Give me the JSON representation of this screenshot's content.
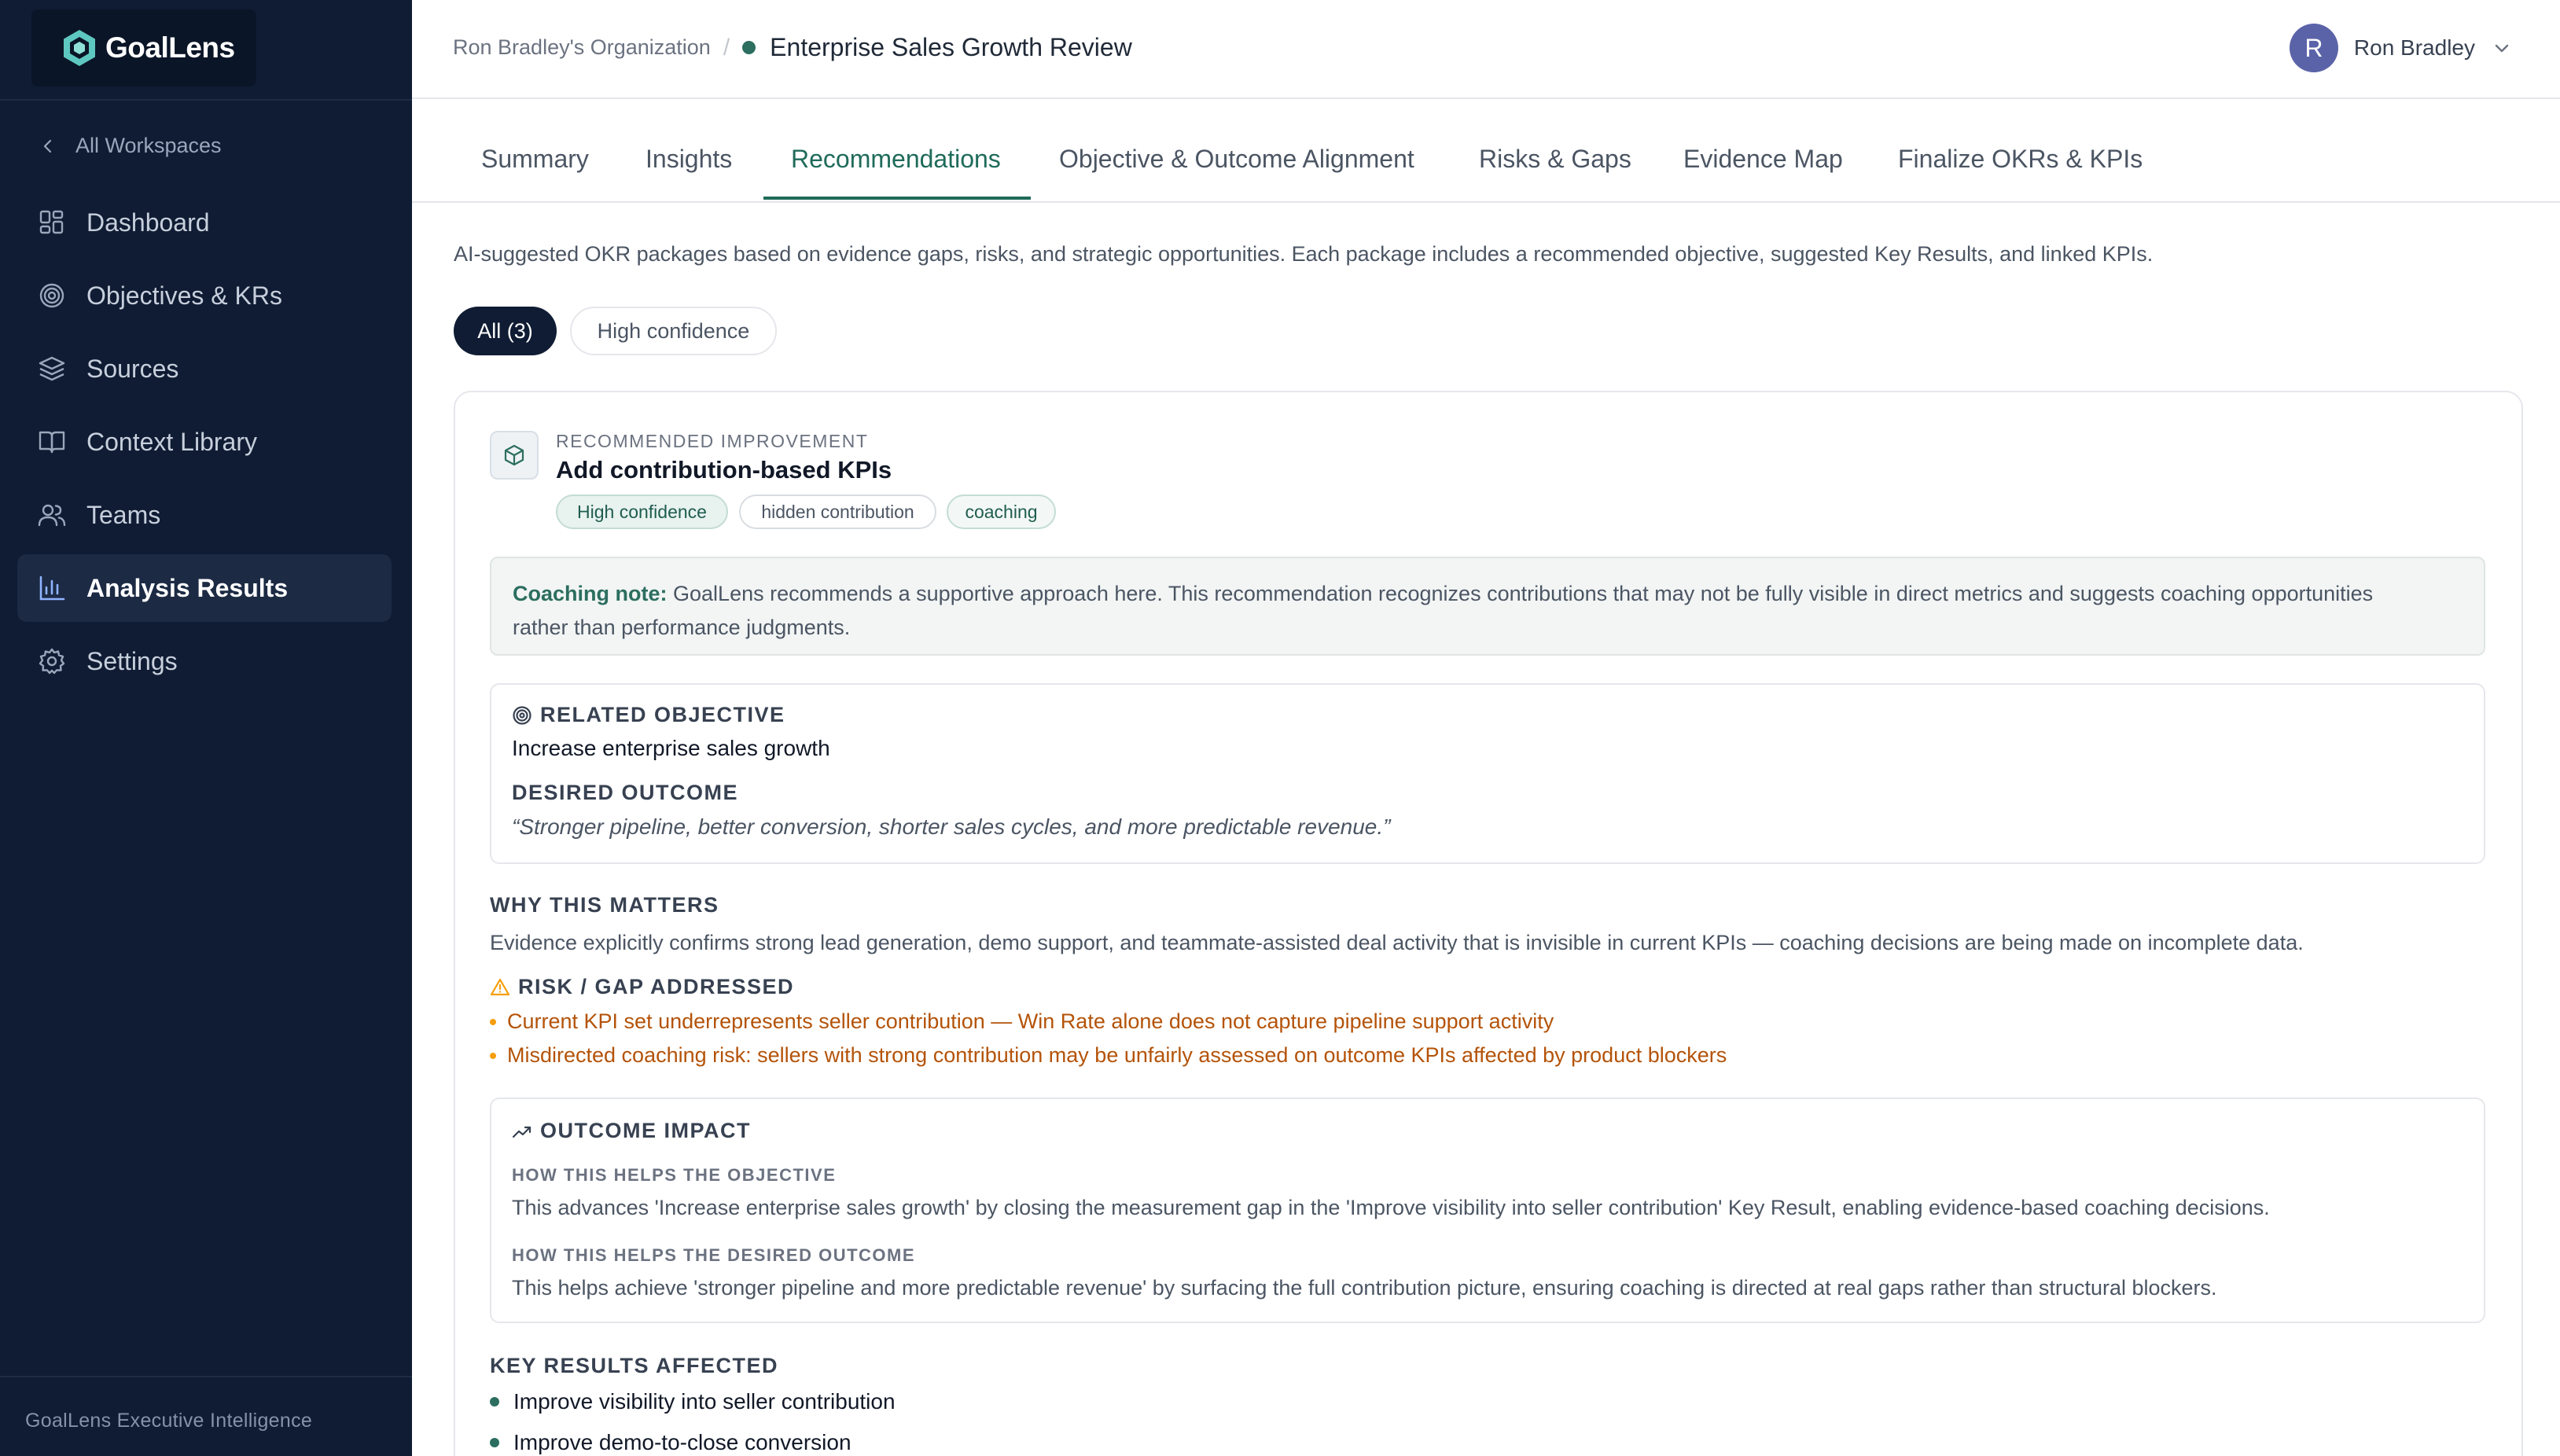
{
  "brand": {
    "name": "GoalLens",
    "logo_icon": "hexagon-logo-icon"
  },
  "sidebar": {
    "back_label": "All Workspaces",
    "items": [
      {
        "label": "Dashboard",
        "icon": "dashboard-icon"
      },
      {
        "label": "Objectives & KRs",
        "icon": "target-icon"
      },
      {
        "label": "Sources",
        "icon": "layers-icon"
      },
      {
        "label": "Context Library",
        "icon": "book-icon"
      },
      {
        "label": "Teams",
        "icon": "users-icon"
      },
      {
        "label": "Analysis Results",
        "icon": "bar-chart-icon",
        "active": true
      },
      {
        "label": "Settings",
        "icon": "gear-icon"
      }
    ],
    "footer": "GoalLens Executive Intelligence"
  },
  "header": {
    "org": "Ron Bradley's Organization",
    "separator": "/",
    "review_title": "Enterprise Sales Growth Review",
    "user_initial": "R",
    "user_name": "Ron Bradley"
  },
  "tabs": [
    {
      "label": "Summary"
    },
    {
      "label": "Insights"
    },
    {
      "label": "Recommendations",
      "active": true
    },
    {
      "label": "Objective & Outcome Alignment"
    },
    {
      "label": "Risks & Gaps"
    },
    {
      "label": "Evidence Map"
    },
    {
      "label": "Finalize OKRs & KPIs"
    }
  ],
  "content": {
    "intro": "AI-suggested OKR packages based on evidence gaps, risks, and strategic opportunities. Each package includes a recommended objective, suggested Key Results, and linked KPIs.",
    "filters": {
      "all": "All (3)",
      "high": "High confidence"
    }
  },
  "recommendation": {
    "eyebrow": "RECOMMENDED IMPROVEMENT",
    "title": "Add contribution-based KPIs",
    "tags": [
      "High confidence",
      "hidden contribution",
      "coaching"
    ],
    "coaching_label": "Coaching note:",
    "coaching_line1": "GoalLens recommends a supportive approach here. This recommendation recognizes contributions that may not be fully visible in direct metrics and suggests coaching opportunities",
    "coaching_line2": "rather than performance judgments.",
    "related_objective_label": "RELATED OBJECTIVE",
    "related_objective": "Increase enterprise sales growth",
    "desired_outcome_label": "DESIRED OUTCOME",
    "desired_outcome": "“Stronger pipeline, better conversion, shorter sales cycles, and more predictable revenue.”",
    "why_label": "WHY THIS MATTERS",
    "why_text": "Evidence explicitly confirms strong lead generation, demo support, and teammate-assisted deal activity that is invisible in current KPIs — coaching decisions are being made on incomplete data.",
    "risk_label": "RISK / GAP ADDRESSED",
    "risks": [
      "Current KPI set underrepresents seller contribution — Win Rate alone does not capture pipeline support activity",
      "Misdirected coaching risk: sellers with strong contribution may be unfairly assessed on outcome KPIs affected by product blockers"
    ],
    "impact_label": "OUTCOME IMPACT",
    "helps_objective_label": "HOW THIS HELPS THE OBJECTIVE",
    "helps_objective": "This advances 'Increase enterprise sales growth' by closing the measurement gap in the 'Improve visibility into seller contribution' Key Result, enabling evidence-based coaching decisions.",
    "helps_outcome_label": "HOW THIS HELPS THE DESIRED OUTCOME",
    "helps_outcome": "This helps achieve 'stronger pipeline and more predictable revenue' by surfacing the full contribution picture, ensuring coaching is directed at real gaps rather than structural blockers.",
    "kr_label": "KEY RESULTS AFFECTED",
    "key_results": [
      "Improve visibility into seller contribution",
      "Improve demo-to-close conversion"
    ]
  },
  "colors": {
    "sidebar_bg": "#0f1c33",
    "accent": "#1f6b5a",
    "warning": "#b45309"
  }
}
